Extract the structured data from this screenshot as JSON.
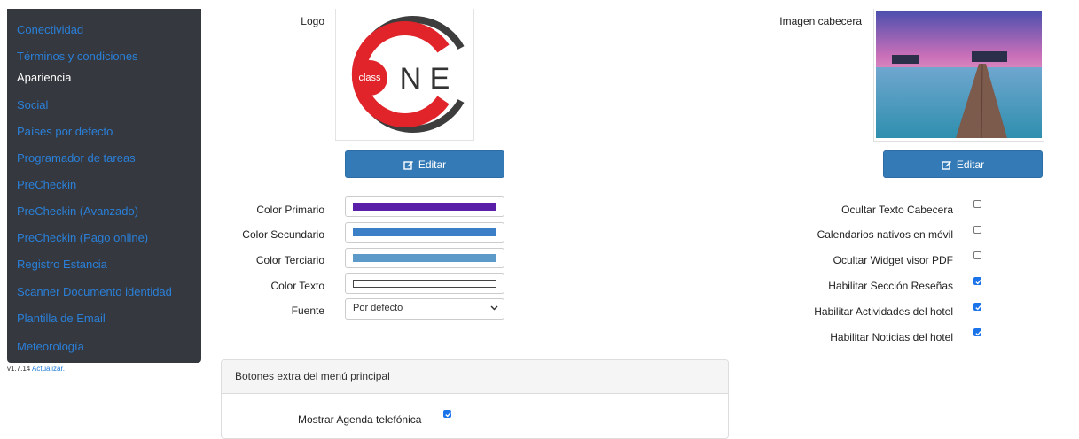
{
  "sidebar": {
    "items": [
      {
        "label": "Conectividad",
        "active": false
      },
      {
        "label": "Términos y condiciones",
        "active": false
      },
      {
        "label": "Apariencia",
        "active": true
      },
      {
        "label": "Social",
        "active": false
      },
      {
        "label": "Países por defecto",
        "active": false
      },
      {
        "label": "Programador de tareas",
        "active": false
      },
      {
        "label": "PreCheckin",
        "active": false
      },
      {
        "label": "PreCheckin (Avanzado)",
        "active": false
      },
      {
        "label": "PreCheckin (Pago online)",
        "active": false
      },
      {
        "label": "Registro Estancia",
        "active": false
      },
      {
        "label": "Scanner Documento identidad",
        "active": false
      },
      {
        "label": "Plantilla de Email",
        "active": false
      },
      {
        "label": "Meteorología",
        "active": false
      }
    ],
    "bg_color": "#35393f",
    "link_color": "#2a7fd9"
  },
  "version": {
    "text": "v1.7.14",
    "update_link": "Actualizar."
  },
  "logo": {
    "label": "Logo",
    "edit_label": "Editar",
    "brand_small": "class",
    "brand_letters": "N E"
  },
  "header_image": {
    "label": "Imagen cabecera",
    "edit_label": "Editar"
  },
  "colors": [
    {
      "label": "Color Primario",
      "value": "#5a1fa8"
    },
    {
      "label": "Color Secundario",
      "value": "#3b7fc6"
    },
    {
      "label": "Color Terciario",
      "value": "#5b9ac9"
    },
    {
      "label": "Color Texto",
      "value": "#ffffff"
    }
  ],
  "font": {
    "label": "Fuente",
    "value": "Por defecto"
  },
  "options": [
    {
      "label": "Ocultar Texto Cabecera",
      "checked": false
    },
    {
      "label": "Calendarios nativos en móvil",
      "checked": false
    },
    {
      "label": "Ocultar Widget visor PDF",
      "checked": false
    },
    {
      "label": "Habilitar Sección Reseñas",
      "checked": true
    },
    {
      "label": "Habilitar Actividades del hotel",
      "checked": true
    },
    {
      "label": "Habilitar Noticias del hotel",
      "checked": true
    }
  ],
  "extra_menu": {
    "title": "Botones extra del menú principal",
    "items": [
      {
        "label": "Mostrar Agenda telefónica",
        "checked": true
      }
    ]
  },
  "accent_color": "#337ab7"
}
